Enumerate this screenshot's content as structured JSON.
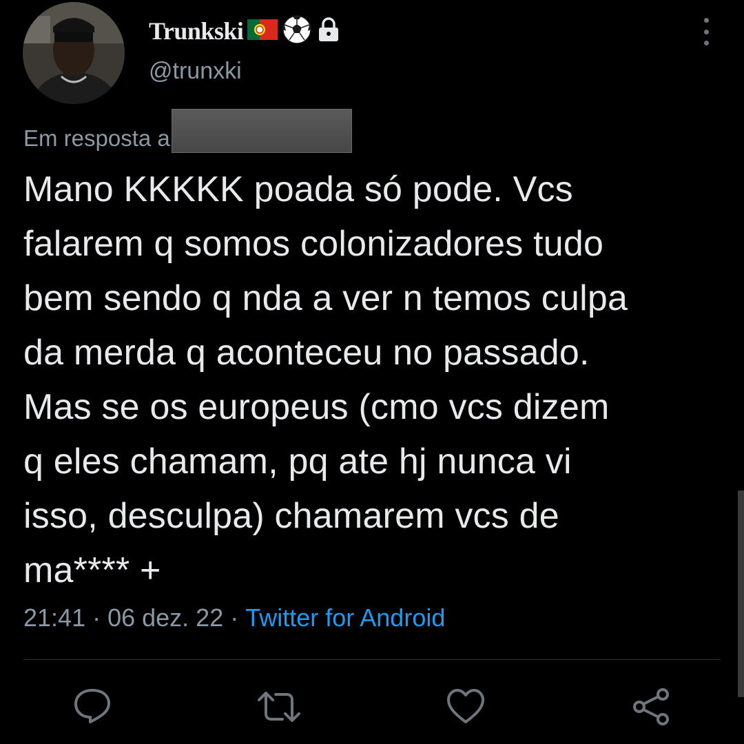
{
  "user": {
    "display_name": "Trunkski",
    "name_emojis": [
      "portugal-flag-icon",
      "soccer-ball-icon",
      "lock-icon"
    ],
    "handle": "@trunxki"
  },
  "reply": {
    "label": "Em resposta a"
  },
  "tweet": {
    "text": "Mano KKKKK poada só pode. Vcs\nfalarem q somos colonizadores tudo\nbem sendo q nda a ver n temos culpa\nda merda q aconteceu no passado.\nMas se os europeus (cmo vcs dizem\nq eles chamam, pq ate hj nunca vi\nisso, desculpa) chamarem vcs de\nma**** +",
    "time": "21:41",
    "separator": " · ",
    "date": "06 dez. 22",
    "source": "Twitter for Android"
  },
  "actions": {
    "icons": [
      "reply-icon",
      "retweet-icon",
      "like-icon",
      "share-icon"
    ]
  },
  "colors": {
    "background": "#000000",
    "text": "#e7e9ea",
    "secondary": "#8b98a5",
    "link": "#1d9bf0",
    "icon": "#6e767d"
  }
}
